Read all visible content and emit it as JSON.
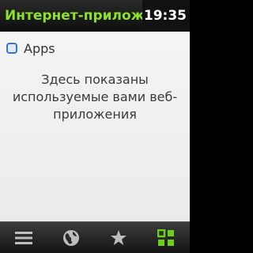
{
  "status": {
    "app_title": "Интернет-приложения",
    "time": "19:35"
  },
  "panel": {
    "header_label": "Apps",
    "header_icon": "apps-icon",
    "message": "Здесь показаны используемые вами веб-приложения"
  },
  "toolbar": {
    "items": [
      {
        "icon": "menu-icon"
      },
      {
        "icon": "globe-icon"
      },
      {
        "icon": "star-icon"
      },
      {
        "icon": "grid-icon",
        "active": true
      }
    ]
  },
  "colors": {
    "title_green": "#8ee02a",
    "active_green": "#6ccf1a",
    "icon_gray": "#bdbdbd"
  }
}
